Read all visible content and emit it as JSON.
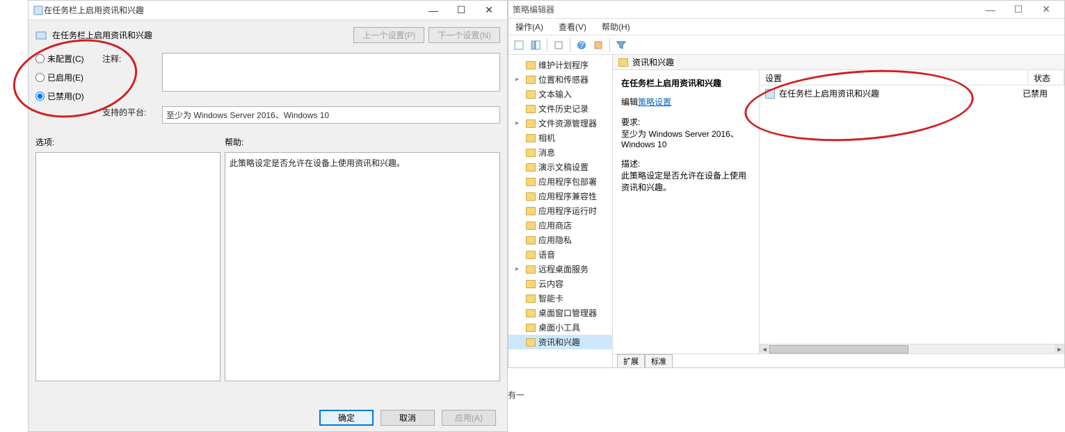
{
  "dialog": {
    "title": "在任务栏上启用资讯和兴趣",
    "heading": "在任务栏上启用资讯和兴趣",
    "prev_btn": "上一个设置(P)",
    "next_btn": "下一个设置(N)",
    "radio_not_configured": "未配置(C)",
    "radio_enabled": "已启用(E)",
    "radio_disabled": "已禁用(D)",
    "comment_label": "注释:",
    "platform_label": "支持的平台:",
    "platform_text": "至少为 Windows Server 2016、Windows 10",
    "options_label": "选项:",
    "help_label": "帮助:",
    "help_text": "此策略设定是否允许在设备上使用资讯和兴趣。",
    "ok_btn": "确定",
    "cancel_btn": "取消",
    "apply_btn": "应用(A)"
  },
  "gpedit": {
    "title_suffix": "策略编辑器",
    "menu": {
      "action": "操作(A)",
      "view": "查看(V)",
      "help": "帮助(H)"
    },
    "tree": [
      "维护计划程序",
      "位置和传感器",
      "文本输入",
      "文件历史记录",
      "文件资源管理器",
      "相机",
      "消息",
      "演示文稿设置",
      "应用程序包部署",
      "应用程序兼容性",
      "应用程序运行时",
      "应用商店",
      "应用隐私",
      "语音",
      "远程桌面服务",
      "云内容",
      "智能卡",
      "桌面窗口管理器",
      "桌面小工具",
      "资讯和兴趣"
    ],
    "main_header": "资讯和兴趣",
    "detail": {
      "title": "在任务栏上启用资讯和兴趣",
      "edit_label": "编辑",
      "edit_link": "策略设置",
      "req_label": "要求:",
      "req_text1": "至少为 Windows Server 2016、",
      "req_text2": "Windows 10",
      "desc_label": "描述:",
      "desc_text": "此策略设定是否允许在设备上使用资讯和兴趣。"
    },
    "list": {
      "col_setting": "设置",
      "col_state": "状态",
      "row_name": "在任务栏上启用资讯和兴趣",
      "row_state": "已禁用"
    },
    "tabs": {
      "extended": "扩展",
      "standard": "标准"
    }
  },
  "fragment": {
    "text": "有一"
  }
}
